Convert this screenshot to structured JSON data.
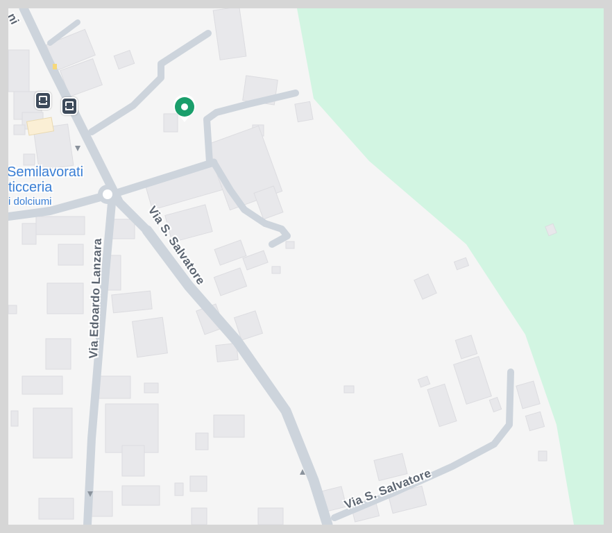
{
  "map": {
    "colors": {
      "land": "#f5f5f5",
      "park": "#d2f5e2",
      "road": "#cdd4dc",
      "building": "#e8e8eb",
      "pin": "#1a9e6b",
      "poi_text": "#3a7fd5",
      "street_text": "#5b6470"
    },
    "streets": {
      "via_edoardo_lanzara": "Via Edoardo Lanzara",
      "via_s_salvatore_1": "Via S. Salvatore",
      "via_s_salvatore_2": "Via S. Salvatore",
      "top_left_fragment": "ni"
    },
    "poi": {
      "line1": "Semilavorati",
      "line2": "ticceria",
      "line3": "i dolciumi"
    },
    "icons": [
      "location-pin-icon",
      "bus-stop-icon",
      "bus-stop-icon",
      "one-way-arrow-icon"
    ]
  }
}
